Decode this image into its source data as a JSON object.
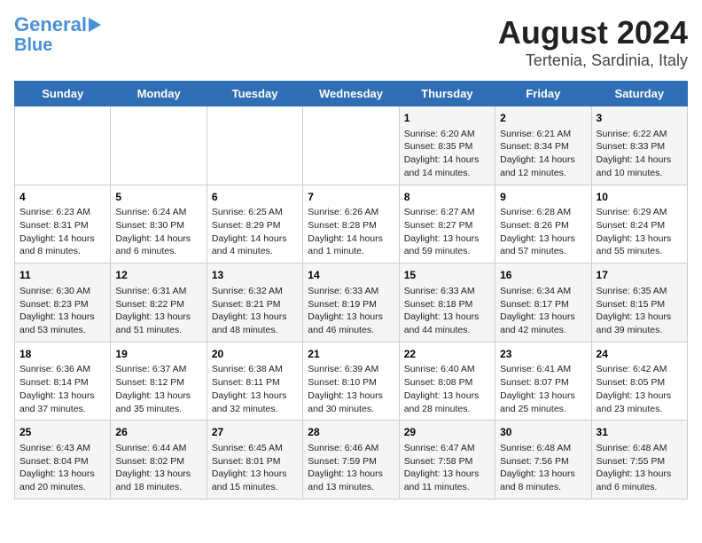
{
  "logo": {
    "line1": "General",
    "line2": "Blue"
  },
  "title": "August 2024",
  "subtitle": "Tertenia, Sardinia, Italy",
  "days_of_week": [
    "Sunday",
    "Monday",
    "Tuesday",
    "Wednesday",
    "Thursday",
    "Friday",
    "Saturday"
  ],
  "weeks": [
    [
      {
        "day": "",
        "info": ""
      },
      {
        "day": "",
        "info": ""
      },
      {
        "day": "",
        "info": ""
      },
      {
        "day": "",
        "info": ""
      },
      {
        "day": "1",
        "info": "Sunrise: 6:20 AM\nSunset: 8:35 PM\nDaylight: 14 hours and 14 minutes."
      },
      {
        "day": "2",
        "info": "Sunrise: 6:21 AM\nSunset: 8:34 PM\nDaylight: 14 hours and 12 minutes."
      },
      {
        "day": "3",
        "info": "Sunrise: 6:22 AM\nSunset: 8:33 PM\nDaylight: 14 hours and 10 minutes."
      }
    ],
    [
      {
        "day": "4",
        "info": "Sunrise: 6:23 AM\nSunset: 8:31 PM\nDaylight: 14 hours and 8 minutes."
      },
      {
        "day": "5",
        "info": "Sunrise: 6:24 AM\nSunset: 8:30 PM\nDaylight: 14 hours and 6 minutes."
      },
      {
        "day": "6",
        "info": "Sunrise: 6:25 AM\nSunset: 8:29 PM\nDaylight: 14 hours and 4 minutes."
      },
      {
        "day": "7",
        "info": "Sunrise: 6:26 AM\nSunset: 8:28 PM\nDaylight: 14 hours and 1 minute."
      },
      {
        "day": "8",
        "info": "Sunrise: 6:27 AM\nSunset: 8:27 PM\nDaylight: 13 hours and 59 minutes."
      },
      {
        "day": "9",
        "info": "Sunrise: 6:28 AM\nSunset: 8:26 PM\nDaylight: 13 hours and 57 minutes."
      },
      {
        "day": "10",
        "info": "Sunrise: 6:29 AM\nSunset: 8:24 PM\nDaylight: 13 hours and 55 minutes."
      }
    ],
    [
      {
        "day": "11",
        "info": "Sunrise: 6:30 AM\nSunset: 8:23 PM\nDaylight: 13 hours and 53 minutes."
      },
      {
        "day": "12",
        "info": "Sunrise: 6:31 AM\nSunset: 8:22 PM\nDaylight: 13 hours and 51 minutes."
      },
      {
        "day": "13",
        "info": "Sunrise: 6:32 AM\nSunset: 8:21 PM\nDaylight: 13 hours and 48 minutes."
      },
      {
        "day": "14",
        "info": "Sunrise: 6:33 AM\nSunset: 8:19 PM\nDaylight: 13 hours and 46 minutes."
      },
      {
        "day": "15",
        "info": "Sunrise: 6:33 AM\nSunset: 8:18 PM\nDaylight: 13 hours and 44 minutes."
      },
      {
        "day": "16",
        "info": "Sunrise: 6:34 AM\nSunset: 8:17 PM\nDaylight: 13 hours and 42 minutes."
      },
      {
        "day": "17",
        "info": "Sunrise: 6:35 AM\nSunset: 8:15 PM\nDaylight: 13 hours and 39 minutes."
      }
    ],
    [
      {
        "day": "18",
        "info": "Sunrise: 6:36 AM\nSunset: 8:14 PM\nDaylight: 13 hours and 37 minutes."
      },
      {
        "day": "19",
        "info": "Sunrise: 6:37 AM\nSunset: 8:12 PM\nDaylight: 13 hours and 35 minutes."
      },
      {
        "day": "20",
        "info": "Sunrise: 6:38 AM\nSunset: 8:11 PM\nDaylight: 13 hours and 32 minutes."
      },
      {
        "day": "21",
        "info": "Sunrise: 6:39 AM\nSunset: 8:10 PM\nDaylight: 13 hours and 30 minutes."
      },
      {
        "day": "22",
        "info": "Sunrise: 6:40 AM\nSunset: 8:08 PM\nDaylight: 13 hours and 28 minutes."
      },
      {
        "day": "23",
        "info": "Sunrise: 6:41 AM\nSunset: 8:07 PM\nDaylight: 13 hours and 25 minutes."
      },
      {
        "day": "24",
        "info": "Sunrise: 6:42 AM\nSunset: 8:05 PM\nDaylight: 13 hours and 23 minutes."
      }
    ],
    [
      {
        "day": "25",
        "info": "Sunrise: 6:43 AM\nSunset: 8:04 PM\nDaylight: 13 hours and 20 minutes."
      },
      {
        "day": "26",
        "info": "Sunrise: 6:44 AM\nSunset: 8:02 PM\nDaylight: 13 hours and 18 minutes."
      },
      {
        "day": "27",
        "info": "Sunrise: 6:45 AM\nSunset: 8:01 PM\nDaylight: 13 hours and 15 minutes."
      },
      {
        "day": "28",
        "info": "Sunrise: 6:46 AM\nSunset: 7:59 PM\nDaylight: 13 hours and 13 minutes."
      },
      {
        "day": "29",
        "info": "Sunrise: 6:47 AM\nSunset: 7:58 PM\nDaylight: 13 hours and 11 minutes."
      },
      {
        "day": "30",
        "info": "Sunrise: 6:48 AM\nSunset: 7:56 PM\nDaylight: 13 hours and 8 minutes."
      },
      {
        "day": "31",
        "info": "Sunrise: 6:48 AM\nSunset: 7:55 PM\nDaylight: 13 hours and 6 minutes."
      }
    ]
  ]
}
